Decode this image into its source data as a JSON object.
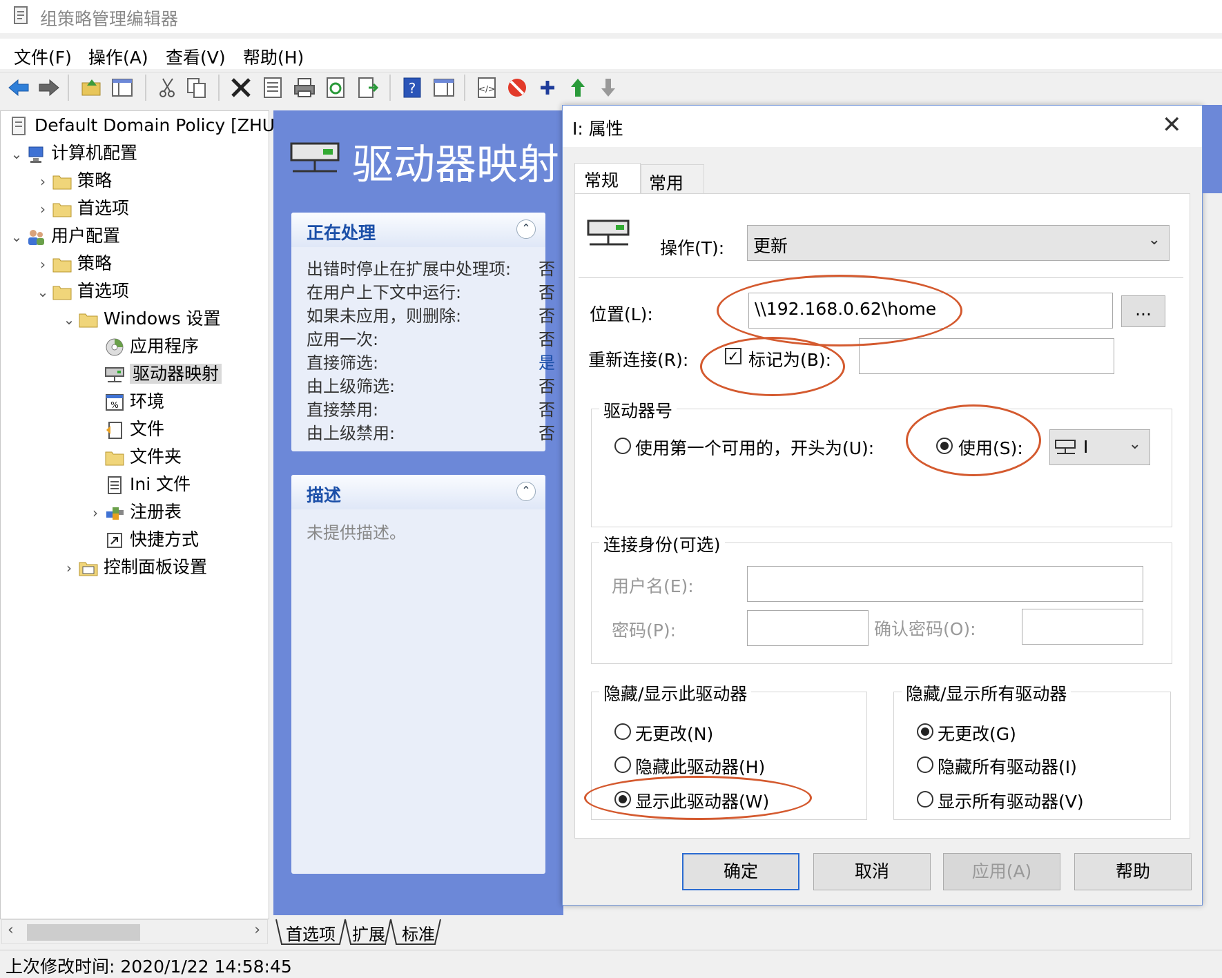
{
  "window": {
    "title": "组策略管理编辑器"
  },
  "menu": [
    "文件(F)",
    "操作(A)",
    "查看(V)",
    "帮助(H)"
  ],
  "tree": {
    "root": "Default Domain Policy [ZHUG",
    "computer_config": "计算机配置",
    "computer_policies": "策略",
    "computer_prefs": "首选项",
    "user_config": "用户配置",
    "user_policies": "策略",
    "user_prefs": "首选项",
    "windows_settings": "Windows 设置",
    "apps": "应用程序",
    "drive_maps": "驱动器映射",
    "environment": "环境",
    "files": "文件",
    "folders": "文件夹",
    "ini_files": "Ini 文件",
    "registry": "注册表",
    "shortcuts": "快捷方式",
    "control_panel": "控制面板设置"
  },
  "middle": {
    "header": "驱动器映射",
    "processing": {
      "title": "正在处理",
      "rows": [
        {
          "label": "出错时停止在扩展中处理项:",
          "value": "否"
        },
        {
          "label": "在用户上下文中运行:",
          "value": "否"
        },
        {
          "label": "如果未应用，则删除:",
          "value": "否"
        },
        {
          "label": "应用一次:",
          "value": "否"
        },
        {
          "label": "直接筛选:",
          "value": "是"
        },
        {
          "label": "由上级筛选:",
          "value": "否"
        },
        {
          "label": "直接禁用:",
          "value": "否"
        },
        {
          "label": "由上级禁用:",
          "value": "否"
        }
      ]
    },
    "description": {
      "title": "描述",
      "text": "未提供描述。"
    },
    "bottom_tabs": [
      "首选项",
      "扩展",
      "标准"
    ]
  },
  "status": {
    "text": "上次修改时间: 2020/1/22 14:58:45"
  },
  "dialog": {
    "title": "I: 属性",
    "tabs": [
      "常规",
      "常用"
    ],
    "action_label": "操作(T):",
    "action_value": "更新",
    "location_label": "位置(L):",
    "location_value": "\\\\192.168.0.62\\home",
    "browse_label": "...",
    "reconnect_label": "重新连接(R):",
    "label_as": "标记为(B):",
    "drive_letter_group": "驱动器号",
    "use_first_available": "使用第一个可用的，开头为(U):",
    "use": "使用(S):",
    "drive_letter_value": "I",
    "connect_as_group": "连接身份(可选)",
    "username_label": "用户名(E):",
    "password_label": "密码(P):",
    "confirm_password_label": "确认密码(O):",
    "hide_show_this_group": "隐藏/显示此驱动器",
    "no_change_n": "无更改(N)",
    "hide_this": "隐藏此驱动器(H)",
    "show_this": "显示此驱动器(W)",
    "hide_show_all_group": "隐藏/显示所有驱动器",
    "no_change_g": "无更改(G)",
    "hide_all": "隐藏所有驱动器(I)",
    "show_all": "显示所有驱动器(V)",
    "ok": "确定",
    "cancel": "取消",
    "apply": "应用(A)",
    "help": "帮助"
  },
  "colors": {
    "accent": "#6c88d8",
    "annotation": "#d45a2f",
    "link_blue": "#1b4fa8"
  }
}
